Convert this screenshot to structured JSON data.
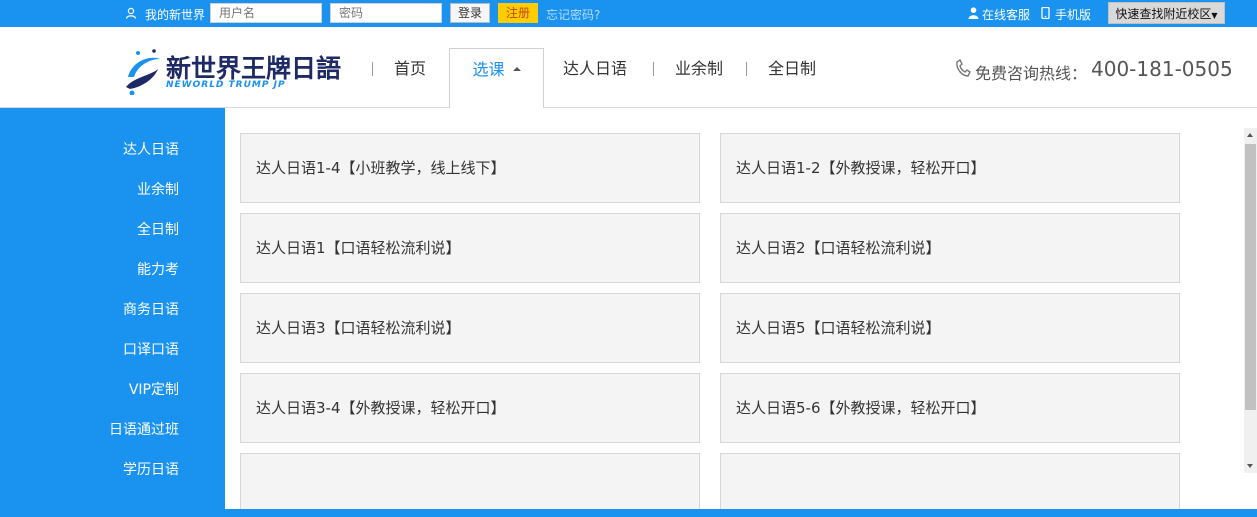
{
  "topbar": {
    "welcome": "我的新世界",
    "username_placeholder": "用户名",
    "password_placeholder": "密码",
    "login": "登录",
    "register": "注册",
    "forgot": "忘记密码?",
    "online_service": "在线客服",
    "mobile": "手机版",
    "campus": "快速查找附近校区"
  },
  "header": {
    "logo_cn": "新世界王牌日語",
    "logo_en": "NEWORLD TRUMP JP",
    "nav": [
      {
        "label": "首页"
      },
      {
        "label": "选课"
      },
      {
        "label": "达人日语"
      },
      {
        "label": "业余制"
      },
      {
        "label": "全日制"
      }
    ],
    "hotline_label": "免费咨询热线：",
    "hotline_number": "400-181-0505"
  },
  "sidebar": {
    "items": [
      "达人日语",
      "业余制",
      "全日制",
      "能力考",
      "商务日语",
      "口译口语",
      "VIP定制",
      "日语通过班",
      "学历日语"
    ]
  },
  "courses": [
    "达人日语1-4【小班教学，线上线下】",
    "达人日语1-2【外教授课，轻松开口】",
    "达人日语1【口语轻松流利说】",
    "达人日语2【口语轻松流利说】",
    "达人日语3【口语轻松流利说】",
    "达人日语5【口语轻松流利说】",
    "达人日语3-4【外教授课，轻松开口】",
    "达人日语5-6【外教授课，轻松开口】",
    "",
    ""
  ],
  "colors": {
    "brand_blue": "#1a92f0",
    "register_yellow": "#ffcc00"
  }
}
